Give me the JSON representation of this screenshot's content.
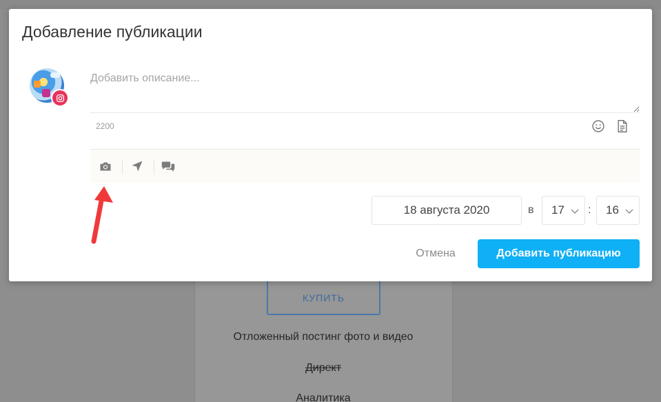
{
  "modal": {
    "title": "Добавление публикации",
    "description_placeholder": "Добавить описание...",
    "description_value": "",
    "char_counter": "2200",
    "date": "18 августа 2020",
    "time_at": "в",
    "hour": "17",
    "time_separator": ":",
    "minute": "16",
    "cancel_label": "Отмена",
    "submit_label": "Добавить публикацию",
    "icons": {
      "emoji": "emoji-icon",
      "template": "document-icon",
      "photo": "camera-icon",
      "location": "location-arrow-icon",
      "comments": "comments-icon",
      "network": "instagram-icon"
    }
  },
  "background": {
    "buy_label": "КУПИТЬ",
    "features": [
      "Отложенный постинг фото и видео",
      "Директ",
      "Аналитика"
    ]
  },
  "colors": {
    "accent": "#0fb0f5",
    "instagram": "#e8335c",
    "annotation_arrow": "#f03a3a"
  }
}
